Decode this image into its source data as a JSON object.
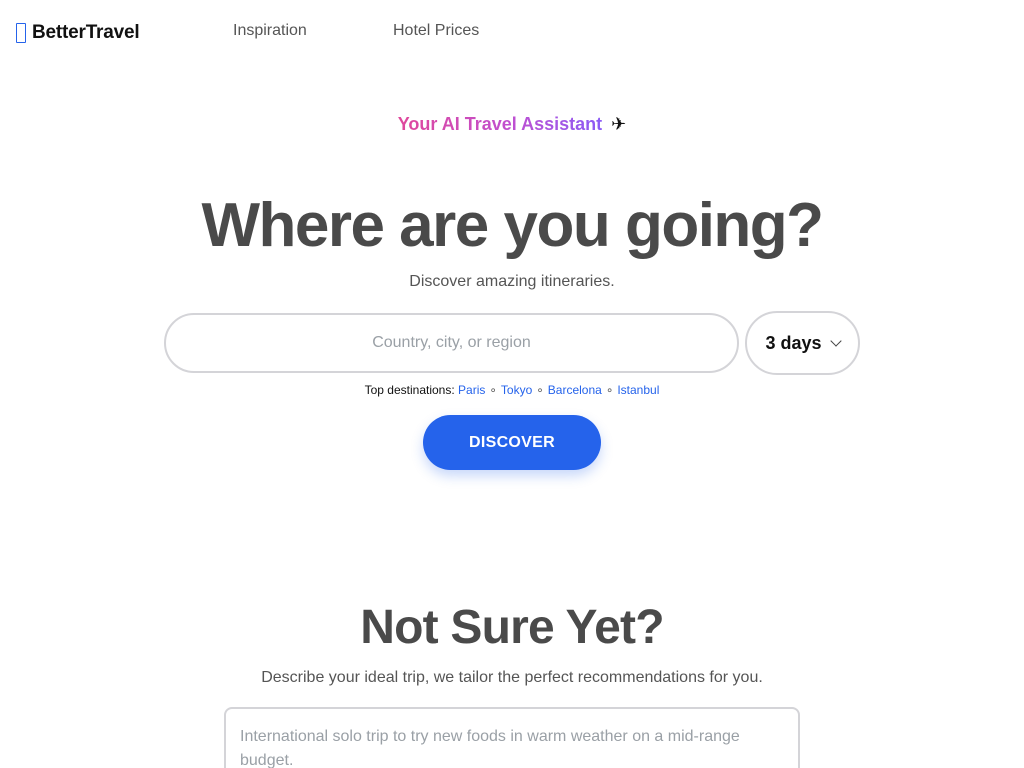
{
  "header": {
    "brand_name": "BetterTravel",
    "brand_icon": "square-outline-icon",
    "nav": [
      {
        "label": "Inspiration"
      },
      {
        "label": "Hotel Prices"
      }
    ]
  },
  "hero": {
    "tagline": "Your AI Travel Assistant",
    "tagline_icon": "✈",
    "title": "Where are you going?",
    "subtitle": "Discover amazing itineraries.",
    "search": {
      "value": "",
      "placeholder": "Country, city, or region"
    },
    "days": {
      "selected": "3 days"
    },
    "top_destinations": {
      "label": "Top destinations:",
      "items": [
        "Paris",
        "Tokyo",
        "Barcelona",
        "Istanbul"
      ],
      "separator": "∘"
    },
    "discover_label": "DISCOVER"
  },
  "not_sure": {
    "title": "Not Sure Yet?",
    "subtitle": "Describe your ideal trip, we tailor the perfect recommendations for you.",
    "textarea": {
      "value": "",
      "placeholder": "International solo trip to try new foods in warm weather on a mid-range budget."
    }
  },
  "colors": {
    "accent": "#2563eb",
    "heading": "#4a4a4a",
    "tagline_gradient_start": "#e0489b",
    "tagline_gradient_end": "#8b5cf6"
  }
}
